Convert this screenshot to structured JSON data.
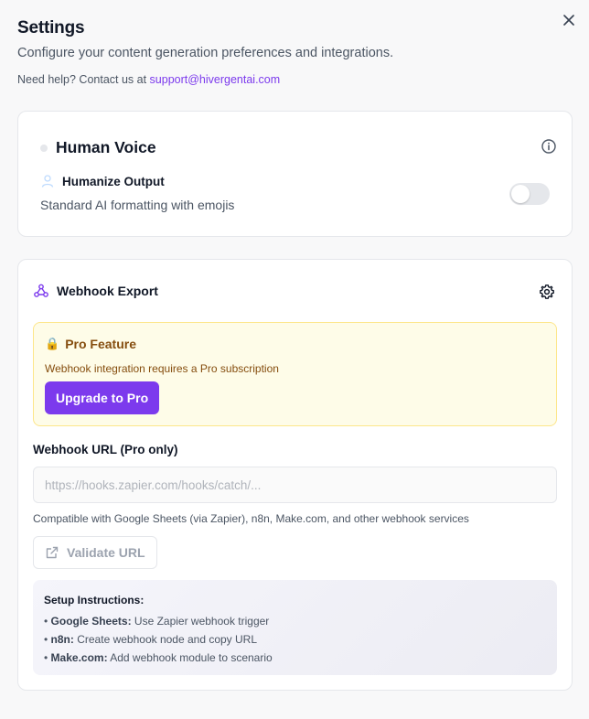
{
  "header": {
    "title": "Settings",
    "subtitle": "Configure your content generation preferences and integrations.",
    "help_prefix": "Need help? Contact us at ",
    "help_email": "support@hivergentai.com"
  },
  "human_voice": {
    "title": "Human Voice",
    "option_label": "Humanize Output",
    "option_description": "Standard AI formatting with emojis",
    "toggle_on": false
  },
  "webhook": {
    "title": "Webhook Export",
    "pro_title": "Pro Feature",
    "pro_description": "Webhook integration requires a Pro subscription",
    "upgrade_label": "Upgrade to Pro",
    "url_label": "Webhook URL (Pro only)",
    "url_value": "",
    "url_placeholder": "https://hooks.zapier.com/hooks/catch/...",
    "compat_text": "Compatible with Google Sheets (via Zapier), n8n, Make.com, and other webhook services",
    "validate_label": "Validate URL",
    "setup": {
      "title": "Setup Instructions:",
      "items": [
        {
          "name": "Google Sheets:",
          "text": " Use Zapier webhook trigger"
        },
        {
          "name": "n8n:",
          "text": " Create webhook node and copy URL"
        },
        {
          "name": "Make.com:",
          "text": " Add webhook module to scenario"
        }
      ]
    }
  },
  "icons": [
    "close-icon",
    "info-icon",
    "user-icon",
    "webhook-icon",
    "gear-icon",
    "lock-icon",
    "external-link-icon"
  ],
  "colors": {
    "accent": "#7c3aed",
    "pro_bg": "#fefce8",
    "pro_border": "#fde68a",
    "pro_text": "#854d0e"
  }
}
